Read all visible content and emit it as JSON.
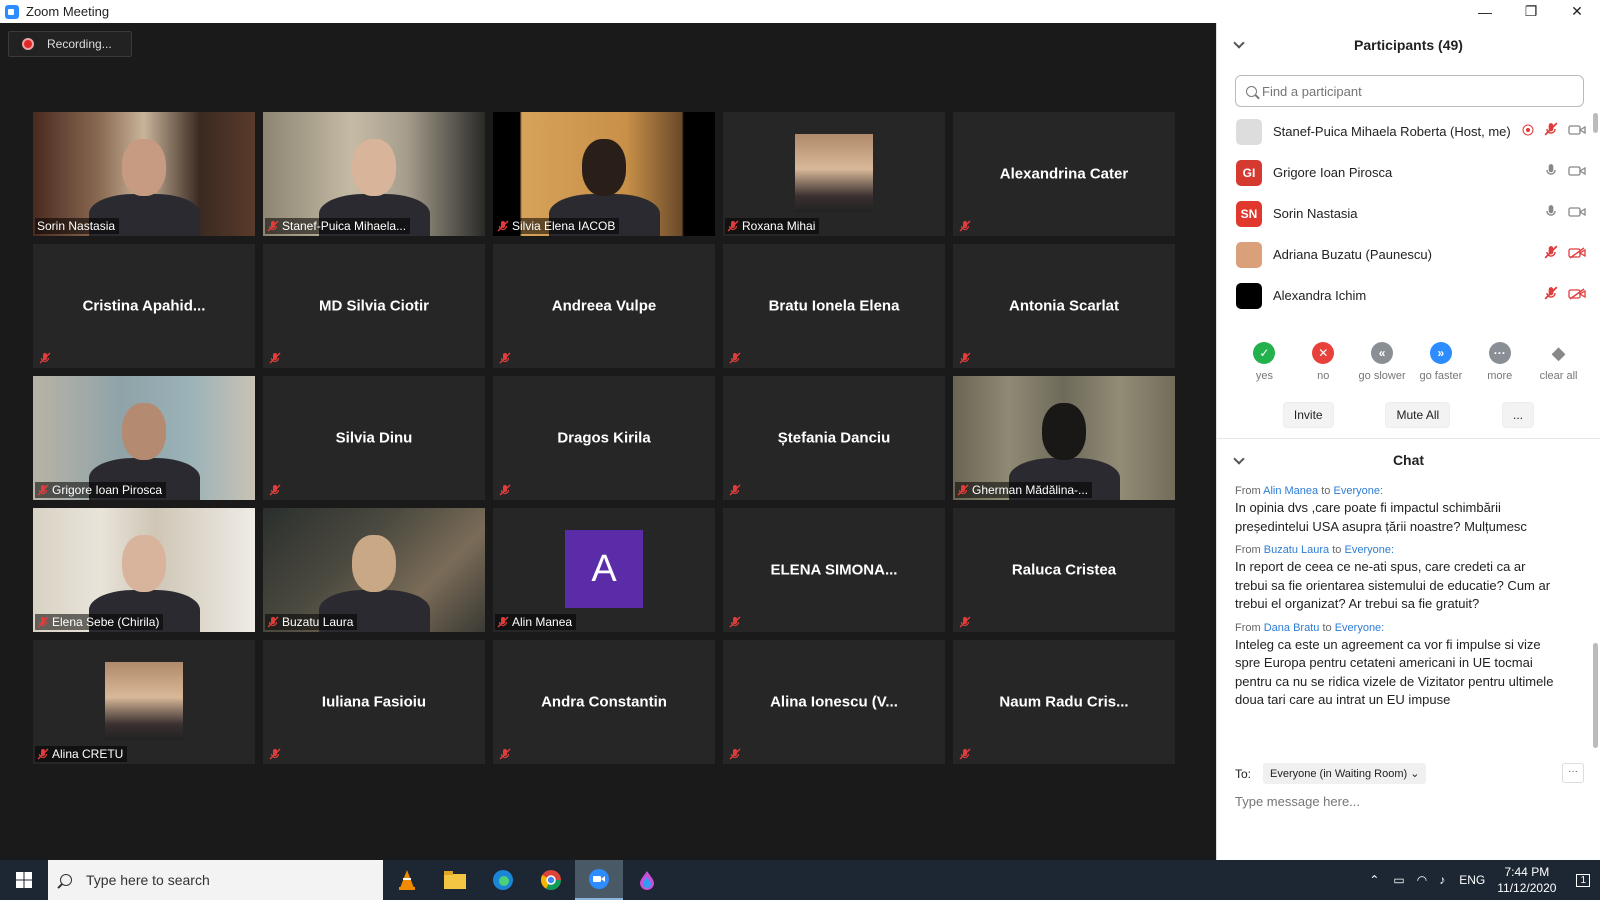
{
  "window": {
    "title": "Zoom Meeting"
  },
  "recording": {
    "label": "Recording..."
  },
  "tiles": [
    {
      "name": "Sorin Nastasia",
      "mode": "video",
      "active": true
    },
    {
      "name": "Stanef-Puica Mihaela...",
      "mode": "video"
    },
    {
      "name": "Silvia Elena IACOB",
      "mode": "video"
    },
    {
      "name": "Roxana Mihai",
      "mode": "photo"
    },
    {
      "name": "Alexandrina Cater",
      "mode": "name"
    },
    {
      "name": "Cristina  Apahid...",
      "mode": "name"
    },
    {
      "name": "MD Silvia Ciotir",
      "mode": "name"
    },
    {
      "name": "Andreea Vulpe",
      "mode": "name"
    },
    {
      "name": "Bratu Ionela Elena",
      "mode": "name"
    },
    {
      "name": "Antonia Scarlat",
      "mode": "name"
    },
    {
      "name": "Grigore Ioan Pirosca",
      "mode": "video"
    },
    {
      "name": "Silvia Dinu",
      "mode": "name"
    },
    {
      "name": "Dragos Kirila",
      "mode": "name"
    },
    {
      "name": "Ștefania Danciu",
      "mode": "name"
    },
    {
      "name": "Gherman Mădălina-...",
      "mode": "video"
    },
    {
      "name": "Elena Sebe (Chirila)",
      "mode": "video"
    },
    {
      "name": "Buzatu Laura",
      "mode": "video"
    },
    {
      "name": "Alin Manea",
      "mode": "letter",
      "letter": "A"
    },
    {
      "name": "ELENA  SIMONA...",
      "mode": "name"
    },
    {
      "name": "Raluca Cristea",
      "mode": "name"
    },
    {
      "name": "Alina CRETU",
      "mode": "photo"
    },
    {
      "name": "Iuliana Fasioiu",
      "mode": "name"
    },
    {
      "name": "Andra Constantin",
      "mode": "name"
    },
    {
      "name": "Alina Ionescu  (V...",
      "mode": "name"
    },
    {
      "name": "Naum  Radu  Cris...",
      "mode": "name"
    }
  ],
  "participants": {
    "title": "Participants (49)",
    "search_placeholder": "Find a participant",
    "list": [
      {
        "name": "Stanef-Puica Mihaela Roberta (Host, me)",
        "avatar": "",
        "avatar_color": "#ddd"
      },
      {
        "name": "Grigore Ioan Pirosca",
        "avatar": "GI",
        "avatar_color": "#d43a2f"
      },
      {
        "name": "Sorin Nastasia",
        "avatar": "SN",
        "avatar_color": "#e0382c"
      },
      {
        "name": "Adriana Buzatu (Paunescu)",
        "avatar": "",
        "avatar_color": "#d9a07a"
      },
      {
        "name": "Alexandra Ichim",
        "avatar": "",
        "avatar_color": "#000000"
      }
    ],
    "reactions": [
      {
        "label": "yes",
        "color": "#22b14c",
        "glyph": "✓"
      },
      {
        "label": "no",
        "color": "#e8403a",
        "glyph": "✕"
      },
      {
        "label": "go slower",
        "color": "#8a8f96",
        "glyph": "«"
      },
      {
        "label": "go faster",
        "color": "#2d8cff",
        "glyph": "»"
      },
      {
        "label": "more",
        "color": "#8a8f96",
        "glyph": "···"
      },
      {
        "label": "clear all",
        "color": "#ffffff",
        "glyph": "◆"
      }
    ],
    "invite": "Invite",
    "mute_all": "Mute All",
    "more": "..."
  },
  "chat": {
    "title": "Chat",
    "messages": [
      {
        "from_prefix": "From",
        "sender": "Alin Manea",
        "to_word": "to",
        "recipient": "Everyone:",
        "text": "In opinia dvs ,care poate fi impactul schimbării președintelui USA asupra țării noastre? Mulțumesc"
      },
      {
        "from_prefix": "From",
        "sender": "Buzatu Laura",
        "to_word": "to",
        "recipient": "Everyone:",
        "text": "In report de ceea ce ne-ati spus, care credeti ca ar trebui sa fie orientarea sistemului de educatie? Cum ar trebui el organizat? Ar trebui sa fie gratuit?"
      },
      {
        "from_prefix": "From",
        "sender": "Dana Bratu",
        "to_word": "to",
        "recipient": "Everyone:",
        "text": "Inteleg ca este un agreement ca vor fi impulse si vize spre Europa pentru cetateni americani in UE tocmai pentru ca nu se ridica vizele de Vizitator pentru ultimele doua tari care au intrat un EU impuse"
      }
    ],
    "to_label": "To:",
    "to_value": "Everyone (in Waiting Room)",
    "input_placeholder": "Type message here...",
    "more": "···"
  },
  "taskbar": {
    "search_text": "Type here to search",
    "language": "ENG",
    "time": "7:44 PM",
    "date": "11/12/2020",
    "notifications": "1"
  }
}
